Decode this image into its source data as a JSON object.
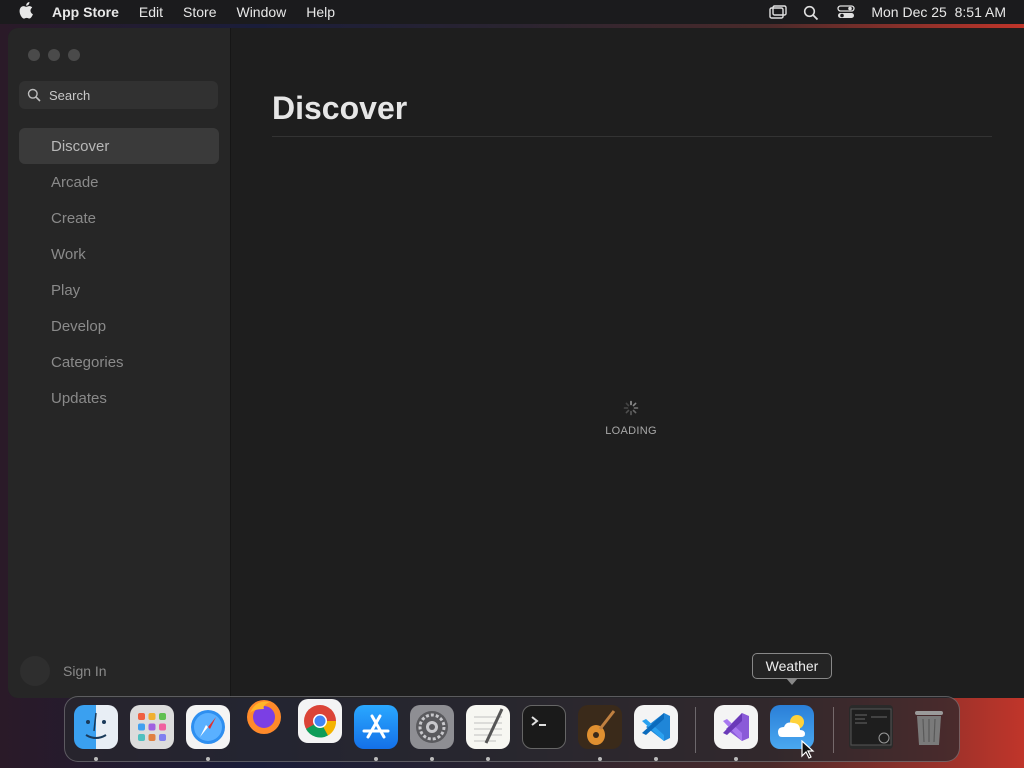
{
  "menubar": {
    "app_name": "App Store",
    "items": [
      "Edit",
      "Store",
      "Window",
      "Help"
    ],
    "clock": "Mon Dec 25  8:51 AM",
    "status_icons": [
      "screen-mirroring-icon",
      "spotlight-search-icon",
      "control-center-icon"
    ]
  },
  "search": {
    "placeholder": "Search"
  },
  "sidebar": {
    "items": [
      {
        "label": "Discover",
        "active": true
      },
      {
        "label": "Arcade"
      },
      {
        "label": "Create"
      },
      {
        "label": "Work"
      },
      {
        "label": "Play"
      },
      {
        "label": "Develop"
      },
      {
        "label": "Categories"
      },
      {
        "label": "Updates"
      }
    ],
    "sign_in": "Sign In"
  },
  "main": {
    "title": "Discover",
    "loading_label": "LOADING"
  },
  "dock": {
    "apps": [
      "Finder",
      "Launchpad",
      "Safari",
      "Firefox",
      "Chrome",
      "App Store",
      "System Settings",
      "TextEdit",
      "Terminal",
      "GarageBand",
      "VS Code",
      "Visual Studio",
      "Weather",
      "Window Preview",
      "Trash"
    ],
    "tooltip": "Weather"
  },
  "colors": {
    "window_bg": "#1e1e1e",
    "sidebar_bg": "#262626",
    "selected_item": "#3a3a3a"
  }
}
